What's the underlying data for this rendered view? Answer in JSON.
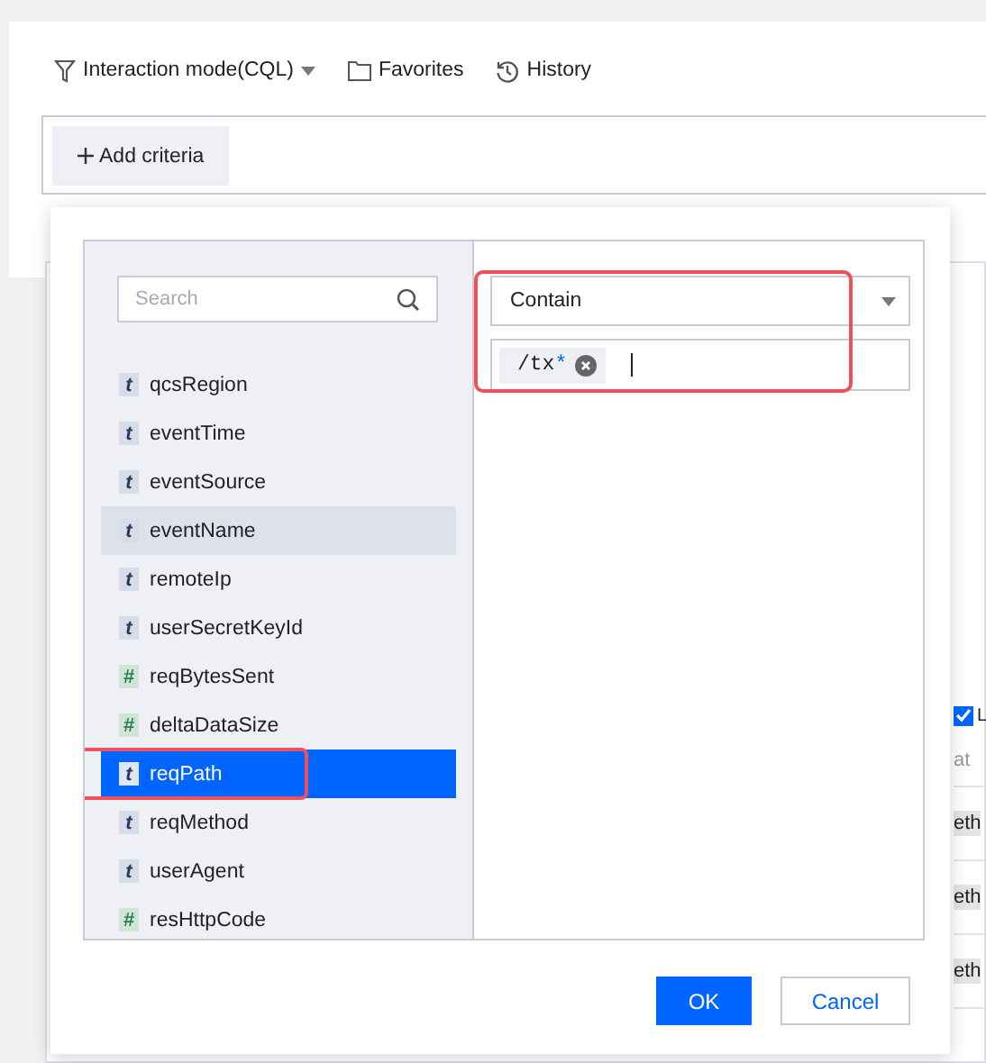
{
  "toolbar": {
    "mode": "Interaction mode(CQL)",
    "favorites": "Favorites",
    "history": "History"
  },
  "criteria": {
    "add": "Add criteria"
  },
  "background_table": {
    "checkbox": {
      "label": "L",
      "checked": true
    },
    "column_header": "at",
    "cells": [
      "eth",
      "eth",
      "eth"
    ]
  },
  "modal": {
    "search": {
      "placeholder": "Search"
    },
    "fields": [
      {
        "badge": "t",
        "kind": "text",
        "name": "qcsRegion",
        "selected": false,
        "hovered": false,
        "highlighted": false
      },
      {
        "badge": "t",
        "kind": "text",
        "name": "eventTime",
        "selected": false,
        "hovered": false,
        "highlighted": false
      },
      {
        "badge": "t",
        "kind": "text",
        "name": "eventSource",
        "selected": false,
        "hovered": false,
        "highlighted": false
      },
      {
        "badge": "t",
        "kind": "text",
        "name": "eventName",
        "selected": false,
        "hovered": true,
        "highlighted": false
      },
      {
        "badge": "t",
        "kind": "text",
        "name": "remoteIp",
        "selected": false,
        "hovered": false,
        "highlighted": false
      },
      {
        "badge": "t",
        "kind": "text",
        "name": "userSecretKeyId",
        "selected": false,
        "hovered": false,
        "highlighted": false
      },
      {
        "badge": "#",
        "kind": "number",
        "name": "reqBytesSent",
        "selected": false,
        "hovered": false,
        "highlighted": false
      },
      {
        "badge": "#",
        "kind": "number",
        "name": "deltaDataSize",
        "selected": false,
        "hovered": false,
        "highlighted": false
      },
      {
        "badge": "t",
        "kind": "text",
        "name": "reqPath",
        "selected": true,
        "hovered": false,
        "highlighted": true
      },
      {
        "badge": "t",
        "kind": "text",
        "name": "reqMethod",
        "selected": false,
        "hovered": false,
        "highlighted": false
      },
      {
        "badge": "t",
        "kind": "text",
        "name": "userAgent",
        "selected": false,
        "hovered": false,
        "highlighted": false
      },
      {
        "badge": "#",
        "kind": "number",
        "name": "resHttpCode",
        "selected": false,
        "hovered": false,
        "highlighted": false
      }
    ],
    "condition": {
      "highlighted": true,
      "operator": "Contain",
      "values": [
        {
          "text": "/tx",
          "wildcard": "*"
        }
      ]
    },
    "buttons": {
      "ok": "OK",
      "cancel": "Cancel"
    }
  }
}
